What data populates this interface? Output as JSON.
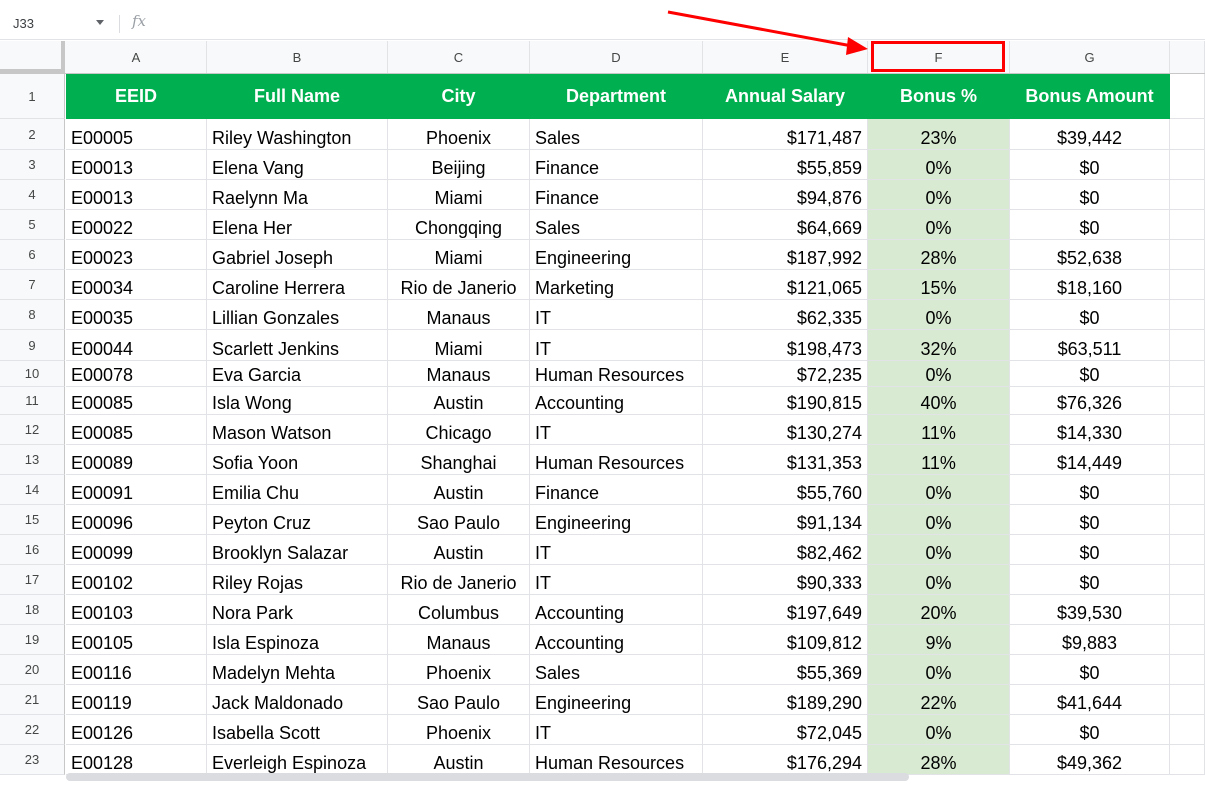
{
  "formula_bar": {
    "namebox": "J33",
    "fx_label": "fx",
    "value": ""
  },
  "columns": [
    "A",
    "B",
    "C",
    "D",
    "E",
    "F",
    "G"
  ],
  "header": [
    "EEID",
    "Full Name",
    "City",
    "Department",
    "Annual Salary",
    "Bonus %",
    "Bonus Amount"
  ],
  "row_numbers": [
    "1",
    "2",
    "3",
    "4",
    "5",
    "6",
    "7",
    "8",
    "9",
    "10",
    "11",
    "12",
    "13",
    "14",
    "15",
    "16",
    "17",
    "18",
    "19",
    "20",
    "21",
    "22",
    "23"
  ],
  "rows": [
    [
      "E00005",
      "Riley Washington",
      "Phoenix",
      "Sales",
      "$171,487",
      "23%",
      "$39,442"
    ],
    [
      "E00013",
      "Elena Vang",
      "Beijing",
      "Finance",
      "$55,859",
      "0%",
      "$0"
    ],
    [
      "E00013",
      "Raelynn Ma",
      "Miami",
      "Finance",
      "$94,876",
      "0%",
      "$0"
    ],
    [
      "E00022",
      "Elena Her",
      "Chongqing",
      "Sales",
      "$64,669",
      "0%",
      "$0"
    ],
    [
      "E00023",
      "Gabriel Joseph",
      "Miami",
      "Engineering",
      "$187,992",
      "28%",
      "$52,638"
    ],
    [
      "E00034",
      "Caroline Herrera",
      "Rio de Janerio",
      "Marketing",
      "$121,065",
      "15%",
      "$18,160"
    ],
    [
      "E00035",
      "Lillian Gonzales",
      "Manaus",
      "IT",
      "$62,335",
      "0%",
      "$0"
    ],
    [
      "E00044",
      "Scarlett Jenkins",
      "Miami",
      "IT",
      "$198,473",
      "32%",
      "$63,511"
    ],
    [
      "E00078",
      "Eva Garcia",
      "Manaus",
      "Human Resources",
      "$72,235",
      "0%",
      "$0"
    ],
    [
      "E00085",
      "Isla Wong",
      "Austin",
      "Accounting",
      "$190,815",
      "40%",
      "$76,326"
    ],
    [
      "E00085",
      "Mason Watson",
      "Chicago",
      "IT",
      "$130,274",
      "11%",
      "$14,330"
    ],
    [
      "E00089",
      "Sofia Yoon",
      "Shanghai",
      "Human Resources",
      "$131,353",
      "11%",
      "$14,449"
    ],
    [
      "E00091",
      "Emilia Chu",
      "Austin",
      "Finance",
      "$55,760",
      "0%",
      "$0"
    ],
    [
      "E00096",
      "Peyton Cruz",
      "Sao Paulo",
      "Engineering",
      "$91,134",
      "0%",
      "$0"
    ],
    [
      "E00099",
      "Brooklyn Salazar",
      "Austin",
      "IT",
      "$82,462",
      "0%",
      "$0"
    ],
    [
      "E00102",
      "Riley Rojas",
      "Rio de Janerio",
      "IT",
      "$90,333",
      "0%",
      "$0"
    ],
    [
      "E00103",
      "Nora Park",
      "Columbus",
      "Accounting",
      "$197,649",
      "20%",
      "$39,530"
    ],
    [
      "E00105",
      "Isla Espinoza",
      "Manaus",
      "Accounting",
      "$109,812",
      "9%",
      "$9,883"
    ],
    [
      "E00116",
      "Madelyn Mehta",
      "Phoenix",
      "Sales",
      "$55,369",
      "0%",
      "$0"
    ],
    [
      "E00119",
      "Jack Maldonado",
      "Sao Paulo",
      "Engineering",
      "$189,290",
      "22%",
      "$41,644"
    ],
    [
      "E00126",
      "Isabella Scott",
      "Phoenix",
      "IT",
      "$72,045",
      "0%",
      "$0"
    ],
    [
      "E00128",
      "Everleigh Espinoza",
      "Austin",
      "Human Resources",
      "$176,294",
      "28%",
      "$49,362"
    ]
  ],
  "colors": {
    "header_bg": "#00b050",
    "bonus_col_bg": "#d9ead3",
    "highlight": "#ff0000"
  }
}
